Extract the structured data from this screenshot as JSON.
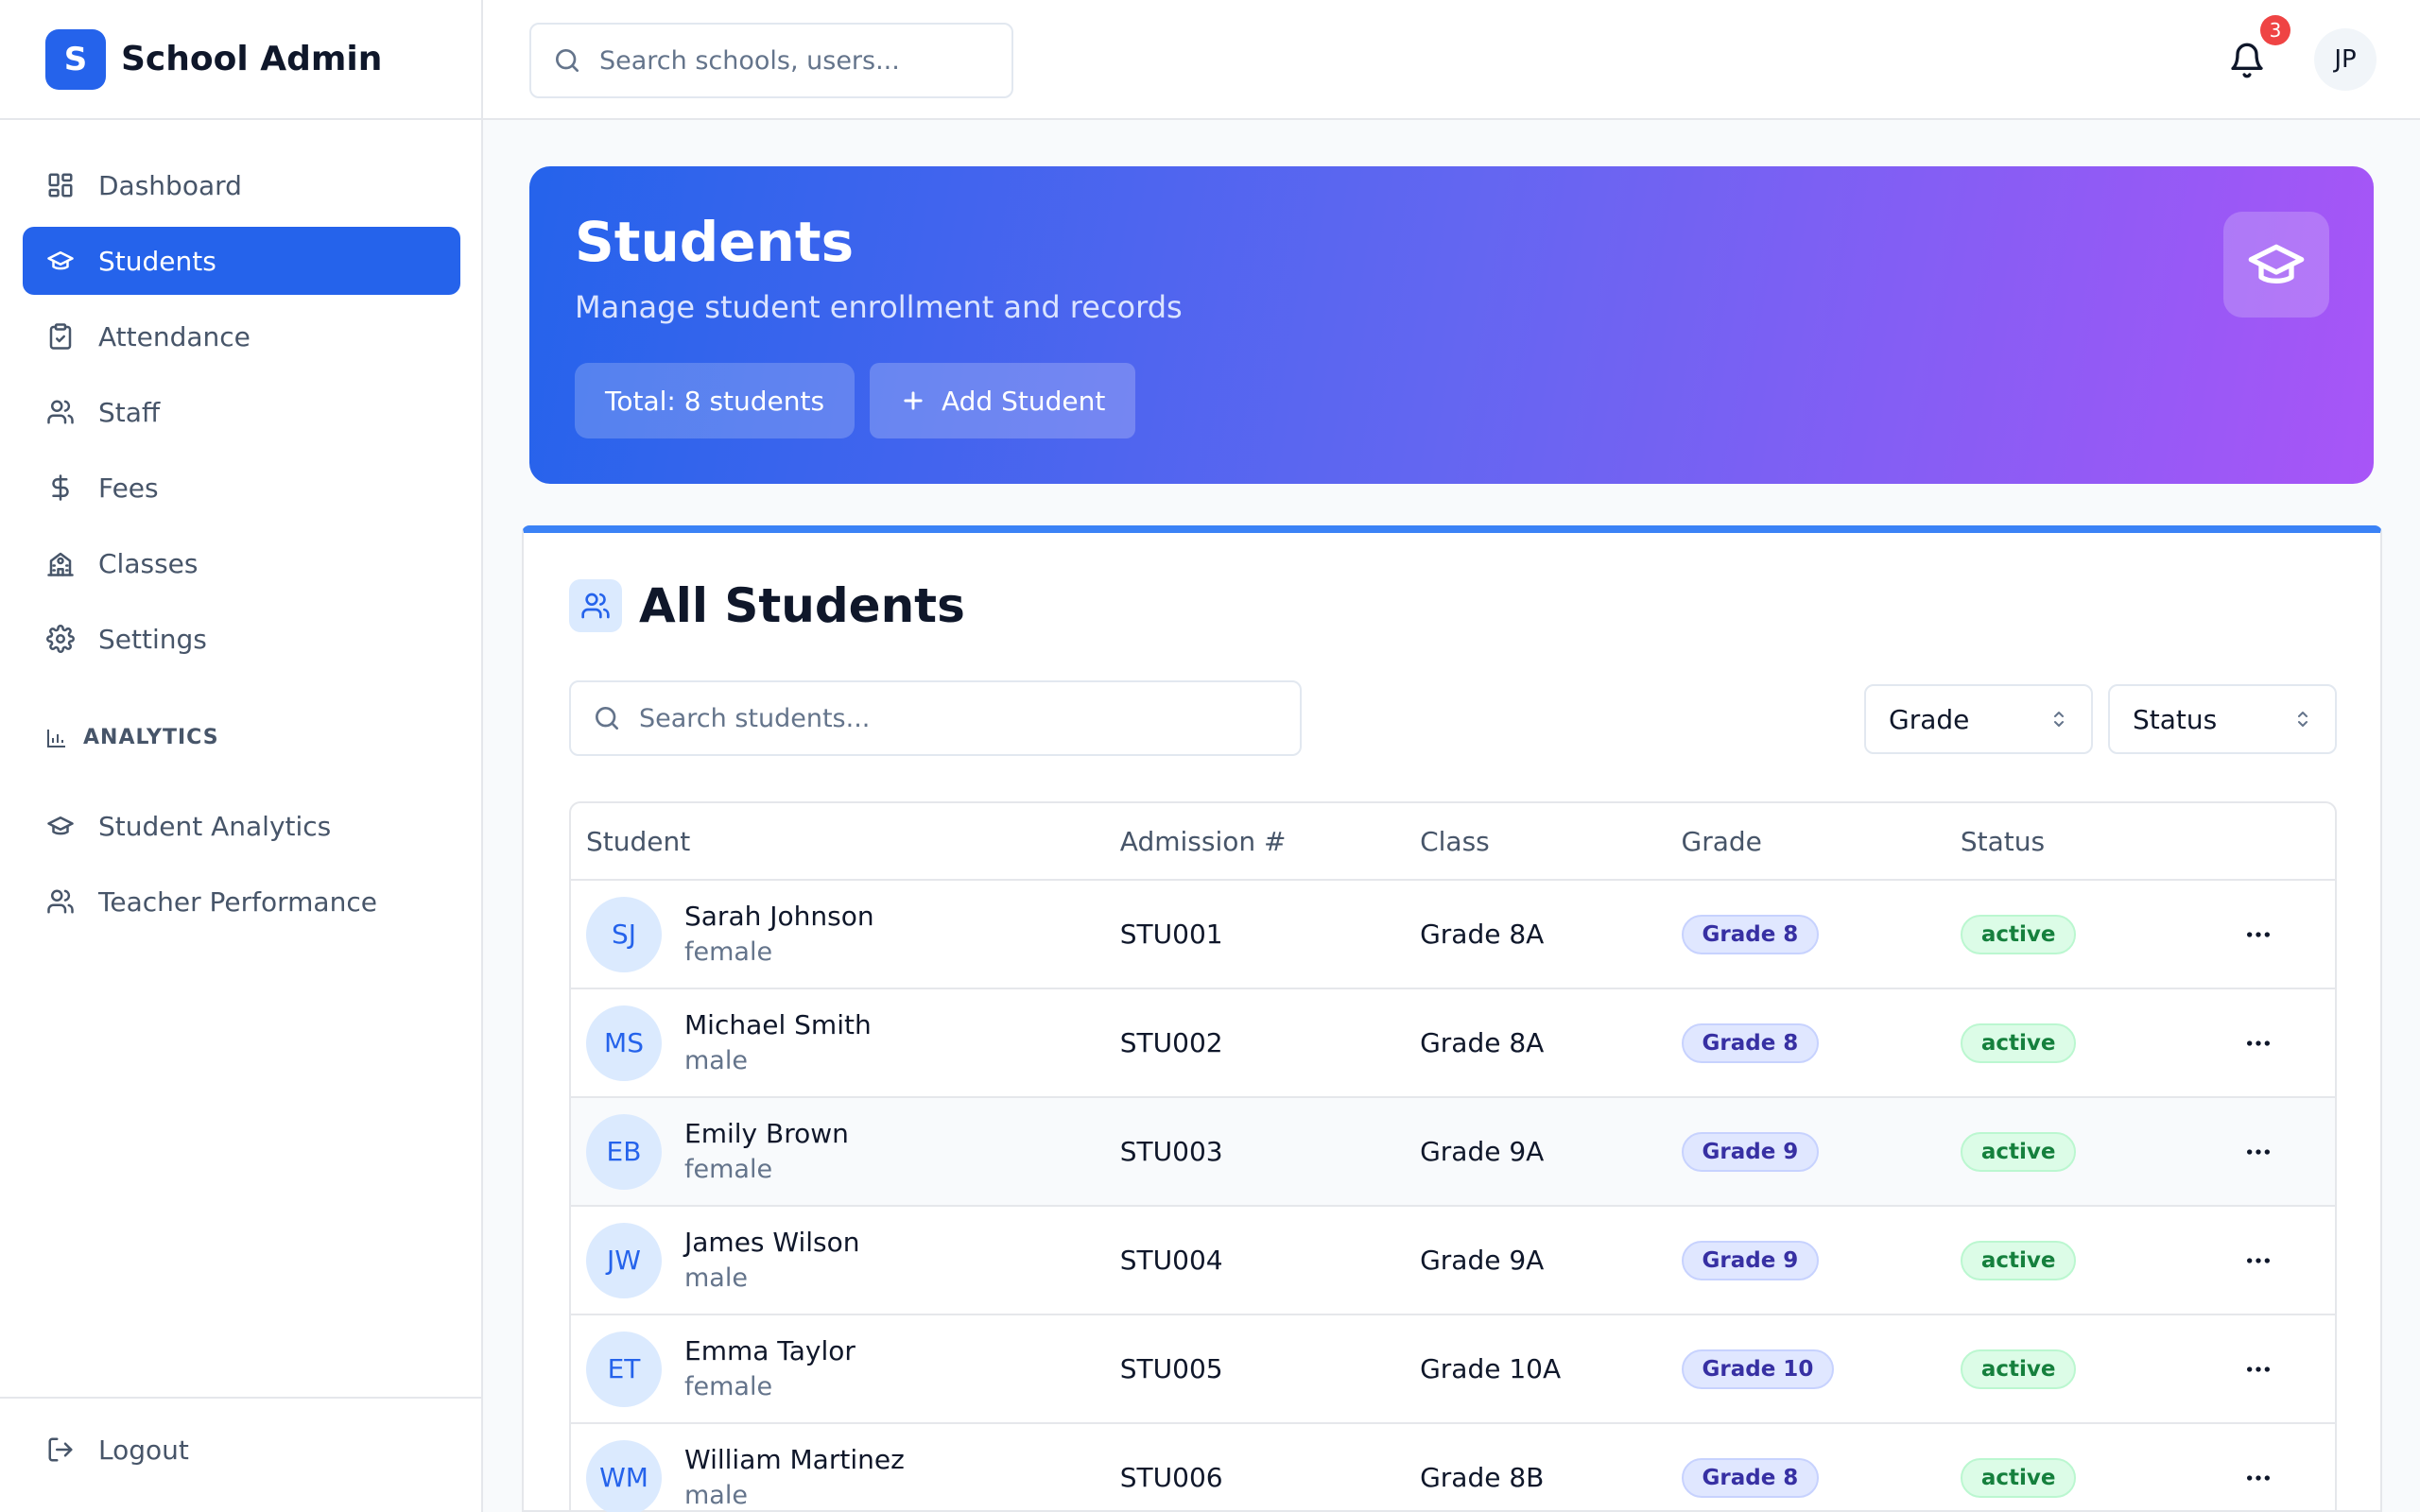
{
  "brand": {
    "logo_letter": "S",
    "name": "School Admin",
    "accent": "#2563eb"
  },
  "search": {
    "placeholder": "Search schools, users..."
  },
  "notifications": {
    "count": "3"
  },
  "user": {
    "initials": "JP"
  },
  "sidebar": {
    "items": [
      {
        "label": "Dashboard",
        "icon": "dashboard-icon"
      },
      {
        "label": "Students",
        "icon": "graduation-cap-icon",
        "active": true
      },
      {
        "label": "Attendance",
        "icon": "clipboard-check-icon"
      },
      {
        "label": "Staff",
        "icon": "users-icon"
      },
      {
        "label": "Fees",
        "icon": "dollar-icon"
      },
      {
        "label": "Classes",
        "icon": "school-icon"
      },
      {
        "label": "Settings",
        "icon": "gear-icon"
      }
    ],
    "section_label": "ANALYTICS",
    "analytics_items": [
      {
        "label": "Student Analytics",
        "icon": "graduation-cap-icon"
      },
      {
        "label": "Teacher Performance",
        "icon": "users-icon"
      }
    ],
    "logout_label": "Logout"
  },
  "hero": {
    "title": "Students",
    "subtitle": "Manage student enrollment and records",
    "total_label": "Total: 8 students",
    "add_label": "Add Student"
  },
  "card": {
    "title": "All Students",
    "search_placeholder": "Search students...",
    "filter_grade": "Grade",
    "filter_status": "Status"
  },
  "table": {
    "headers": [
      "Student",
      "Admission #",
      "Class",
      "Grade",
      "Status"
    ],
    "rows": [
      {
        "initials": "SJ",
        "name": "Sarah Johnson",
        "gender": "female",
        "admission": "STU001",
        "class": "Grade 8A",
        "grade": "Grade 8",
        "status": "active"
      },
      {
        "initials": "MS",
        "name": "Michael Smith",
        "gender": "male",
        "admission": "STU002",
        "class": "Grade 8A",
        "grade": "Grade 8",
        "status": "active"
      },
      {
        "initials": "EB",
        "name": "Emily Brown",
        "gender": "female",
        "admission": "STU003",
        "class": "Grade 9A",
        "grade": "Grade 9",
        "status": "active"
      },
      {
        "initials": "JW",
        "name": "James Wilson",
        "gender": "male",
        "admission": "STU004",
        "class": "Grade 9A",
        "grade": "Grade 9",
        "status": "active"
      },
      {
        "initials": "ET",
        "name": "Emma Taylor",
        "gender": "female",
        "admission": "STU005",
        "class": "Grade 10A",
        "grade": "Grade 10",
        "status": "active"
      },
      {
        "initials": "WM",
        "name": "William Martinez",
        "gender": "male",
        "admission": "STU006",
        "class": "Grade 8B",
        "grade": "Grade 8",
        "status": "active"
      }
    ]
  }
}
